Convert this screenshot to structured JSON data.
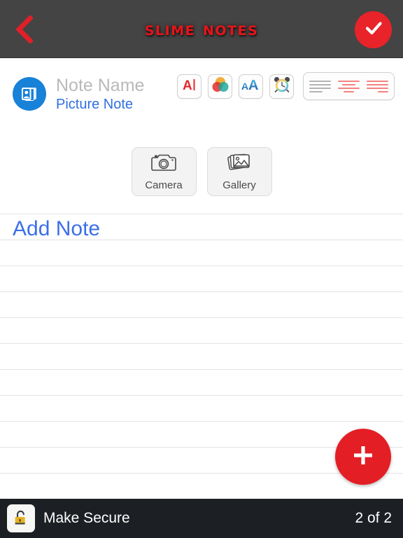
{
  "header": {
    "back_icon": "chevron-left-icon",
    "title": "Slime Notes",
    "confirm_icon": "check-icon",
    "accent_red": "#e8131a",
    "bar_bg": "#444444"
  },
  "note_meta": {
    "type_icon": "picture-stack-icon",
    "type_icon_bg": "#1881d8",
    "name_value": "",
    "name_placeholder": "Note Name",
    "type_label": "Picture Note",
    "type_label_color": "#2f6fe0"
  },
  "format_toolbar": {
    "buttons": [
      {
        "name": "text-color-icon",
        "label": "A"
      },
      {
        "name": "color-wheel-icon",
        "label": ""
      },
      {
        "name": "font-size-icon",
        "label": "AA"
      },
      {
        "name": "alarm-clock-icon",
        "label": ""
      }
    ],
    "align": {
      "selected": "left",
      "options": [
        {
          "name": "align-left-icon",
          "value": "left",
          "color": "#b3b3b3"
        },
        {
          "name": "align-center-icon",
          "value": "center",
          "color": "#f4827f"
        },
        {
          "name": "align-right-icon",
          "value": "right",
          "color": "#f4827f"
        }
      ]
    }
  },
  "source_buttons": [
    {
      "name": "camera-button",
      "icon": "camera-icon",
      "label": "Camera"
    },
    {
      "name": "gallery-button",
      "icon": "gallery-icon",
      "label": "Gallery"
    }
  ],
  "note_body": {
    "text_value": "",
    "text_placeholder": "Add Note",
    "text_color": "#3b6fe8",
    "rule_color": "#e4e4e4",
    "fab_icon": "plus-icon",
    "fab_color": "#e31e24"
  },
  "bottom_bar": {
    "lock_icon": "unlocked-padlock-icon",
    "lock_color": "#e8b320",
    "secure_label": "Make Secure",
    "page_counter": "2 of 2",
    "bg": "#1c1f24"
  }
}
